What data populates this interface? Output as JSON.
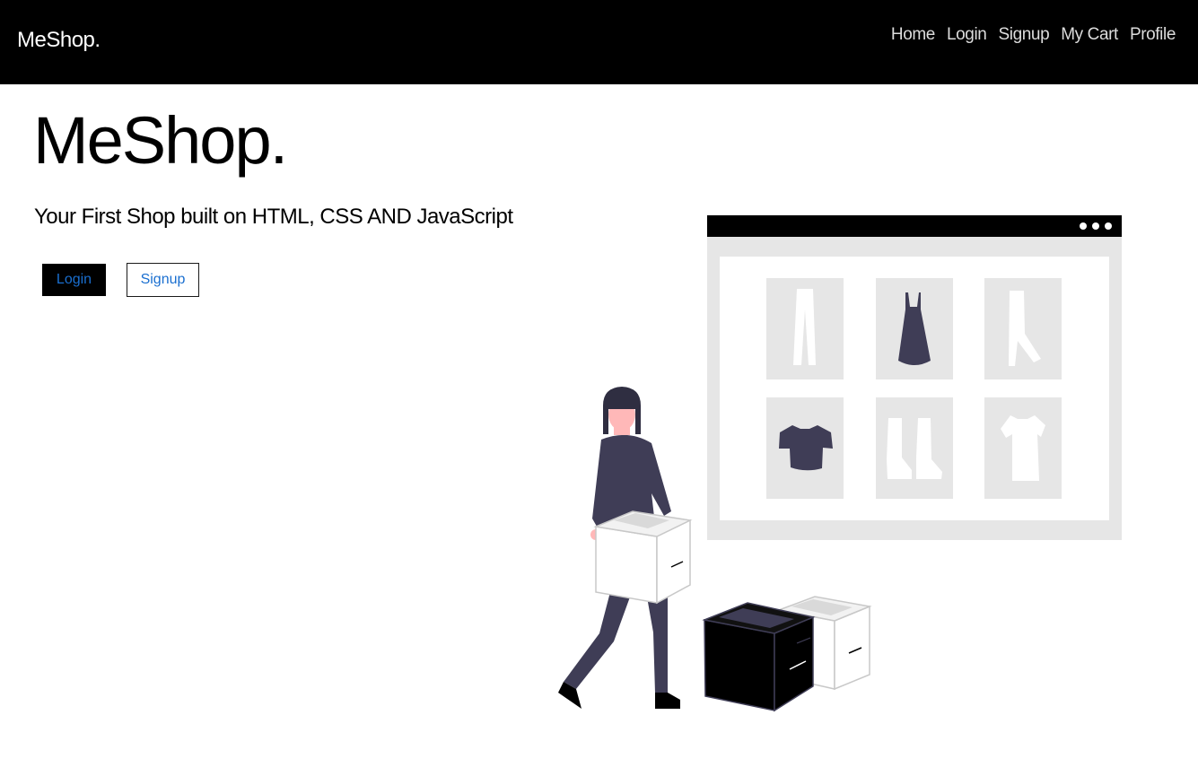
{
  "navbar": {
    "brand": "MeShop.",
    "links": [
      {
        "label": "Home"
      },
      {
        "label": "Login"
      },
      {
        "label": "Signup"
      },
      {
        "label": "My Cart"
      },
      {
        "label": "Profile"
      }
    ]
  },
  "hero": {
    "title": "MeShop.",
    "subtitle": "Your First Shop built on HTML, CSS AND JavaScript",
    "buttons": {
      "login_label": "Login",
      "signup_label": "Signup"
    }
  },
  "colors": {
    "navbar_bg": "#000000",
    "link_blue": "#1a6fd0",
    "illustration_dark": "#3f3d56",
    "illustration_gray": "#e6e6e6",
    "skin": "#ffb8b8"
  }
}
